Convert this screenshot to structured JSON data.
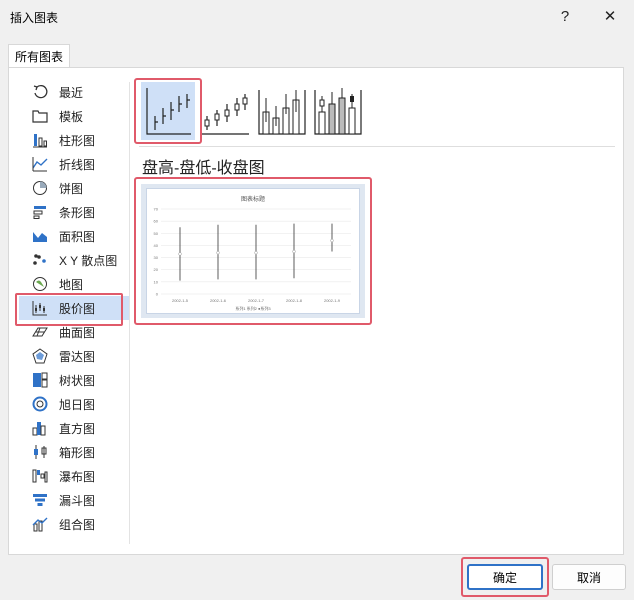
{
  "window": {
    "title": "插入图表",
    "help_label": "?",
    "close_label": "✕"
  },
  "tabs": [
    {
      "label": "所有图表"
    }
  ],
  "chart_types": [
    {
      "label": "最近",
      "icon": "recent-icon"
    },
    {
      "label": "模板",
      "icon": "template-icon"
    },
    {
      "label": "柱形图",
      "icon": "column-chart-icon"
    },
    {
      "label": "折线图",
      "icon": "line-chart-icon"
    },
    {
      "label": "饼图",
      "icon": "pie-chart-icon"
    },
    {
      "label": "条形图",
      "icon": "bar-chart-icon"
    },
    {
      "label": "面积图",
      "icon": "area-chart-icon"
    },
    {
      "label": "X Y 散点图",
      "icon": "scatter-chart-icon"
    },
    {
      "label": "地图",
      "icon": "map-chart-icon"
    },
    {
      "label": "股价图",
      "icon": "stock-chart-icon",
      "selected": true
    },
    {
      "label": "曲面图",
      "icon": "surface-chart-icon"
    },
    {
      "label": "雷达图",
      "icon": "radar-chart-icon"
    },
    {
      "label": "树状图",
      "icon": "treemap-chart-icon"
    },
    {
      "label": "旭日图",
      "icon": "sunburst-chart-icon"
    },
    {
      "label": "直方图",
      "icon": "histogram-chart-icon"
    },
    {
      "label": "箱形图",
      "icon": "boxwhisker-chart-icon"
    },
    {
      "label": "瀑布图",
      "icon": "waterfall-chart-icon"
    },
    {
      "label": "漏斗图",
      "icon": "funnel-chart-icon"
    },
    {
      "label": "组合图",
      "icon": "combo-chart-icon"
    }
  ],
  "subtype_title": "盘高-盘低-收盘图",
  "preview": {
    "chart_title": "图表标题",
    "legend_text": "系列1 系列2 ●系列3",
    "chart_data": {
      "type": "stock",
      "categories": [
        "2002-1-5",
        "2002-1-6",
        "2002-1-7",
        "2002-1-8",
        "2002-1-9"
      ],
      "series": [
        {
          "values": [
            55,
            57,
            57,
            58,
            58
          ]
        },
        {
          "values": [
            11,
            12,
            12,
            13,
            35
          ]
        },
        {
          "values": [
            33,
            34,
            34,
            35,
            44
          ]
        }
      ],
      "ylim": [
        0,
        70
      ],
      "yticks": [
        0,
        10,
        20,
        30,
        40,
        50,
        60,
        70
      ]
    }
  },
  "buttons": {
    "ok": "确定",
    "cancel": "取消"
  },
  "colors": {
    "selection": "#cfe0f7",
    "highlight_frame": "#e05a6a",
    "accent": "#2f72c7"
  }
}
